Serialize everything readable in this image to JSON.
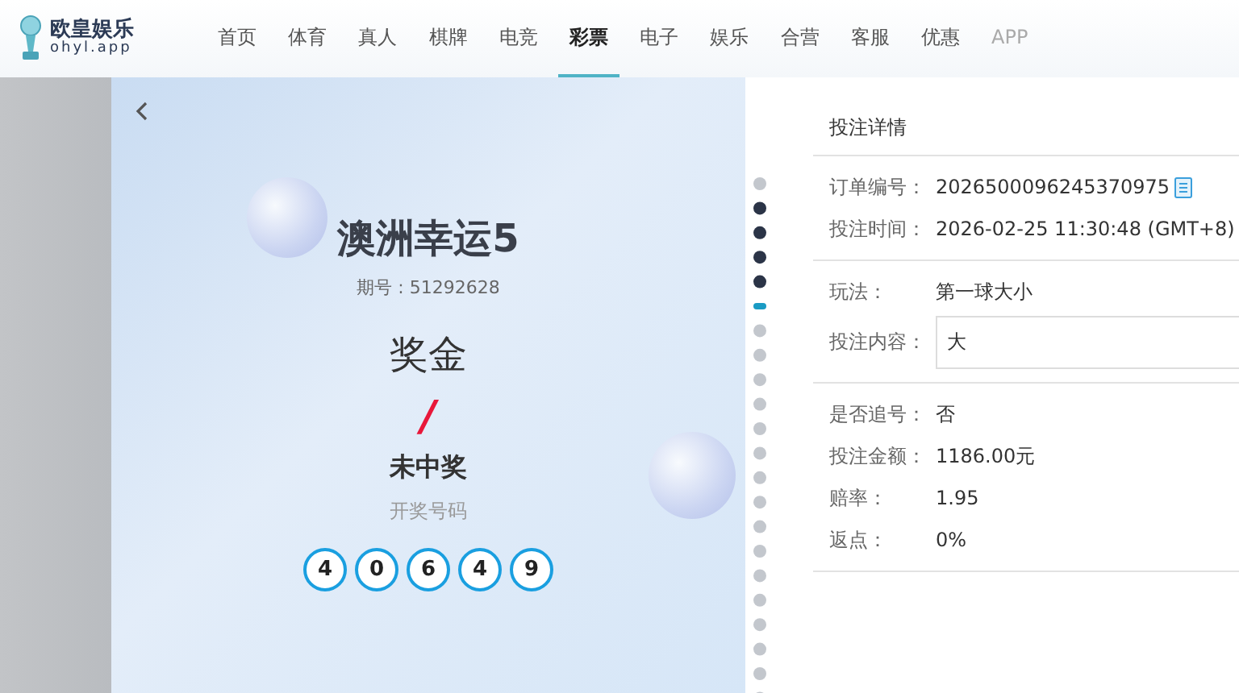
{
  "header": {
    "logo": {
      "name": "欧皇娱乐",
      "domain": "ohyl.app"
    },
    "nav": [
      {
        "label": "首页",
        "selected": false
      },
      {
        "label": "体育",
        "selected": false
      },
      {
        "label": "真人",
        "selected": false
      },
      {
        "label": "棋牌",
        "selected": false
      },
      {
        "label": "电竞",
        "selected": false
      },
      {
        "label": "彩票",
        "selected": true
      },
      {
        "label": "电子",
        "selected": false
      },
      {
        "label": "娱乐",
        "selected": false
      },
      {
        "label": "合营",
        "selected": false
      },
      {
        "label": "客服",
        "selected": false
      },
      {
        "label": "优惠",
        "selected": false
      },
      {
        "label": "APP",
        "selected": false
      }
    ]
  },
  "ticket": {
    "title": "澳洲幸运5",
    "period": "期号 : 51292628",
    "prize_label": "奖金",
    "prize_value": "/",
    "result": "未中奖",
    "numbers_label": "开奖号码",
    "numbers": [
      "4",
      "0",
      "6",
      "4",
      "9"
    ]
  },
  "details": {
    "title": "投注详情",
    "sections": [
      [
        {
          "label": "订单编号：",
          "value": "2026500096245370975",
          "kind": "copy"
        },
        {
          "label": "投注时间：",
          "value": "2026-02-25 11:30:48 (GMT+8)",
          "kind": "text"
        }
      ],
      [
        {
          "label": "玩法：",
          "value": "第一球大小",
          "kind": "text"
        },
        {
          "label": "投注内容：",
          "value": "大",
          "kind": "box"
        }
      ],
      [
        {
          "label": "是否追号：",
          "value": "否",
          "kind": "text"
        },
        {
          "label": "投注金额：",
          "value": "1186.00元",
          "kind": "text"
        },
        {
          "label": "赔率：",
          "value": "1.95",
          "kind": "text"
        },
        {
          "label": "返点：",
          "value": "0%",
          "kind": "text"
        }
      ]
    ]
  }
}
